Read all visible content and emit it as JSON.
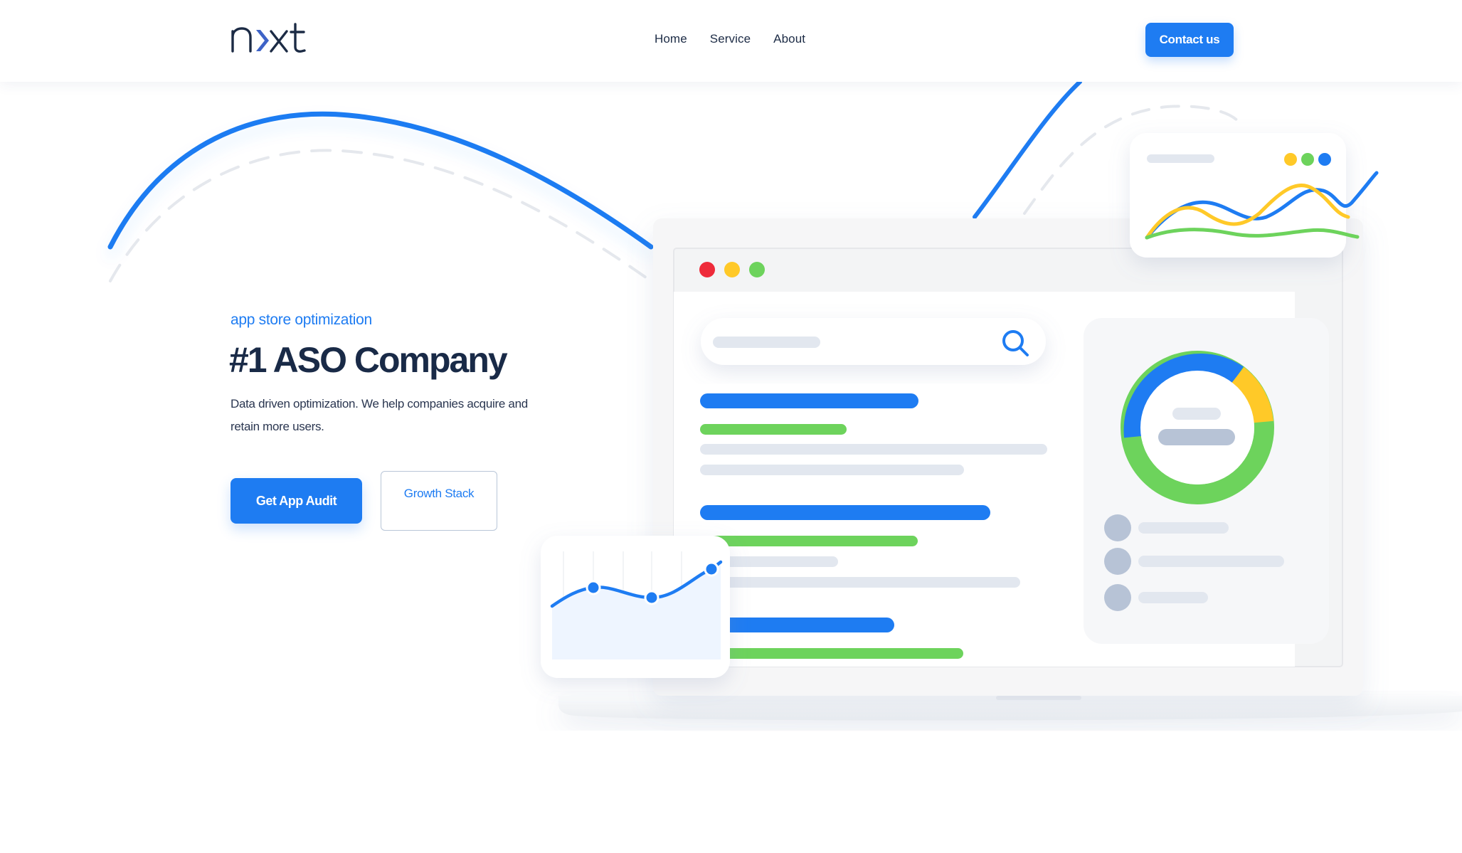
{
  "brand": {
    "logo_text": "nxt"
  },
  "nav": {
    "items": [
      {
        "label": "Home"
      },
      {
        "label": "Service"
      },
      {
        "label": "About"
      }
    ],
    "contact_label": "Contact us"
  },
  "hero": {
    "eyebrow": "app store optimization",
    "title": "#1 ASO Company",
    "description": "Data driven optimization. We help companies acquire and retain more users.",
    "primary_cta": "Get App Audit",
    "secondary_cta": "Growth Stack"
  },
  "colors": {
    "accent": "#1e7cf2",
    "heading": "#192a47",
    "green": "#6dd35c",
    "yellow": "#ffc928",
    "red": "#ee2b3a",
    "placeholder": "#e2e7ef"
  },
  "icons": [
    "search-icon",
    "logo-chevron-icon"
  ]
}
